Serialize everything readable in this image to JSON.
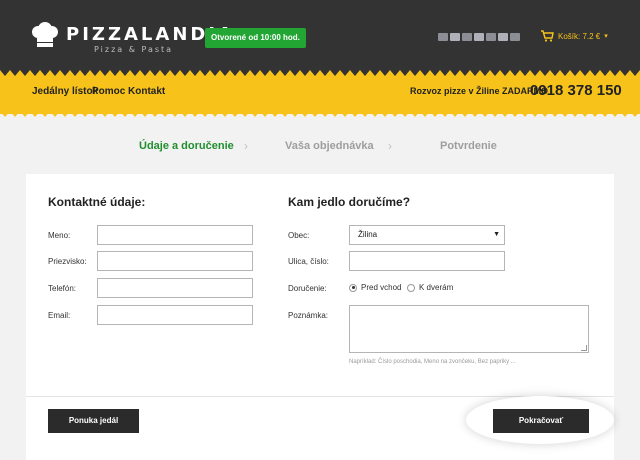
{
  "header": {
    "logo_title": "PIZZALANDIA",
    "logo_subtitle": "Pizza & Pasta",
    "open_badge": "Otvorené od 10:00 hod.",
    "cart_label": "Košík: 7.2 €",
    "cart_chevron": "▾"
  },
  "nav": {
    "items": [
      {
        "label": "Jedálny lístok"
      },
      {
        "label": "Pomoc"
      },
      {
        "label": "Kontakt"
      }
    ],
    "promo": "Rozvoz pizze v Žiline ZADARMO",
    "phone": "0918 378 150"
  },
  "steps": [
    {
      "label": "Údaje a doručenie",
      "state": "active"
    },
    {
      "label": "Vaša objednávka",
      "state": "inactive"
    },
    {
      "label": "Potvrdenie",
      "state": "inactive"
    }
  ],
  "step_separator": "›",
  "contact": {
    "title": "Kontaktné údaje:",
    "fields": [
      {
        "label": "Meno:",
        "value": ""
      },
      {
        "label": "Priezvisko:",
        "value": ""
      },
      {
        "label": "Telefón:",
        "value": ""
      },
      {
        "label": "Email:",
        "value": ""
      }
    ]
  },
  "delivery": {
    "title": "Kam jedlo doručíme?",
    "city_label": "Obec:",
    "city_value": "Žilina",
    "street_label": "Ulica, číslo:",
    "street_value": "",
    "method_label": "Doručenie:",
    "methods": [
      {
        "label": "Pred vchod",
        "selected": true
      },
      {
        "label": "K dverám",
        "selected": false
      }
    ],
    "note_label": "Poznámka:",
    "note_value": "",
    "note_hint": "Napríklad: Číslo poschodia, Meno na zvončeku, Bez papriky ..."
  },
  "actions": {
    "menu_button": "Ponuka jedál",
    "continue_button": "Pokračovať"
  },
  "colors": {
    "header_bg": "#333333",
    "accent_yellow": "#f7c21a",
    "badge_green": "#22a532",
    "step_active": "#1f8f2e"
  },
  "icons": [
    "chef-hat-icon",
    "cart-icon",
    "chevron-right-icon",
    "chevron-down-icon"
  ]
}
